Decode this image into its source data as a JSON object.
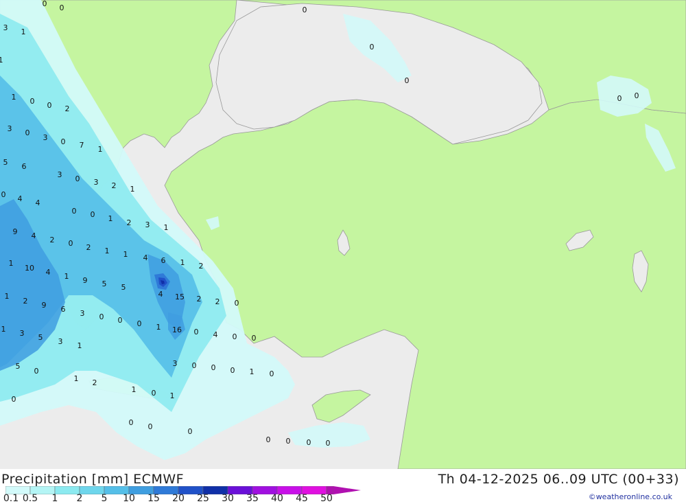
{
  "header": {
    "title_left": "Precipitation [mm] ECMWF",
    "title_right": "Th 04-12-2025 06..09 UTC (00+33)"
  },
  "legend": {
    "labels": [
      "0.1",
      "0.5",
      "1",
      "2",
      "5",
      "10",
      "15",
      "20",
      "25",
      "30",
      "35",
      "40",
      "45",
      "50"
    ],
    "colors": [
      "#d3fafa",
      "#b4f5f5",
      "#8ceaf0",
      "#6ed6ec",
      "#55bfe8",
      "#3f9ee0",
      "#2f7ad8",
      "#2051c8",
      "#1030a8",
      "#6a10d8",
      "#a010e0",
      "#c810e8",
      "#e010e0",
      "#b010b0"
    ]
  },
  "credit": "©weatheronline.co.uk",
  "map": {
    "sea_color": "#ececec",
    "land_color": "#c5f5a0",
    "border_color": "#999999",
    "labels": [
      "0",
      "0",
      "3",
      "1",
      "1",
      "1",
      "0",
      "0",
      "2",
      "3",
      "0",
      "3",
      "0",
      "7",
      "1",
      "5",
      "6",
      "3",
      "0",
      "3",
      "2",
      "1",
      "0",
      "4",
      "4",
      "0",
      "0",
      "1",
      "2",
      "3",
      "1",
      "9",
      "4",
      "2",
      "0",
      "2",
      "1",
      "1",
      "4",
      "6",
      "1",
      "2",
      "1",
      "10",
      "4",
      "1",
      "9",
      "5",
      "5",
      "4",
      "15",
      "2",
      "2",
      "0",
      "1",
      "2",
      "9",
      "6",
      "3",
      "0",
      "0",
      "0",
      "1",
      "16",
      "0",
      "4",
      "0",
      "0",
      "1",
      "3",
      "5",
      "3",
      "1",
      "5",
      "0",
      "3",
      "0",
      "0",
      "0",
      "1",
      "0",
      "1",
      "2",
      "1",
      "0",
      "1",
      "0",
      "0",
      "0",
      "0",
      "0",
      "0",
      "0",
      "0",
      "0",
      "0",
      "0",
      "0",
      "0"
    ]
  }
}
